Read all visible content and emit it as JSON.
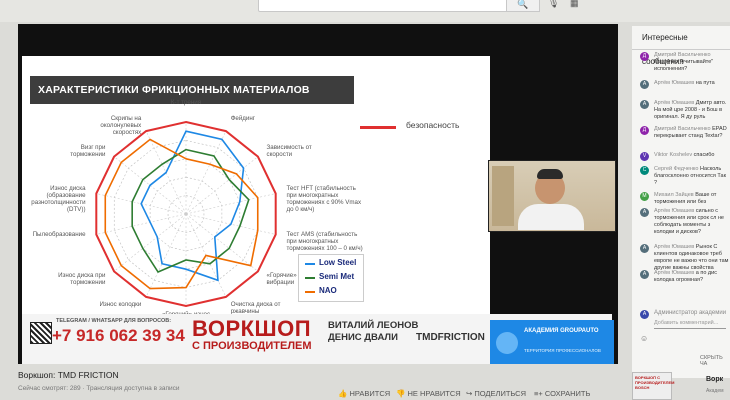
{
  "browser": {
    "search_button": "🔍"
  },
  "slide": {
    "title": "ХАРАКТЕРИСТИКИ ФРИКЦИОННЫХ МАТЕРИАЛОВ",
    "legend_top": "безопасность",
    "axes": [
      "К-т трения",
      "Фейдинг",
      "Зависимость от скорости",
      "Тест HFT (стабильность при многократных торможениях с 90% Vmax до 0 км/ч)",
      "Тест AMS (стабильность при многократных торможениях 100 – 0 км/ч)",
      "«Горячие» вибрации",
      "Очистка диска от ржавчины",
      "«Горячий» износ колодки",
      "Износ колодки",
      "Износ диска при торможении",
      "Пылеобразование",
      "Износ диска (образование разнотолщинности (DTV))",
      "Визг при торможении",
      "Скрипы на околонулевых скоростях"
    ],
    "legend": [
      {
        "name": "Low Steel",
        "color": "#1e88e5"
      },
      {
        "name": "Semi Met",
        "color": "#2e7d32"
      },
      {
        "name": "NAO",
        "color": "#ef6c00"
      }
    ],
    "safety_color": "#e03030"
  },
  "chart_data": {
    "type": "radar",
    "categories": [
      "К-т трения",
      "Фейдинг",
      "Зависимость от скорости",
      "Тест HFT (стабильность при многократных торможениях с 90% Vmax до 0 км/ч)",
      "Тест AMS (стабильность при многократных торможениях 100 – 0 км/ч)",
      "«Горячие» вибрации",
      "Очистка диска от ржавчины",
      "«Горячий» износ колодки",
      "Износ колодки",
      "Износ диска при торможении",
      "Пылеобразование",
      "Износ диска (образование разнотолщинности (DTV))",
      "Визг при торможении",
      "Скрипы на околонулевых скоростях"
    ],
    "scale_max": 5,
    "series": [
      {
        "name": "безопасность",
        "values": [
          5,
          5,
          5,
          5,
          5,
          5,
          5,
          5,
          5,
          5,
          5,
          5,
          5,
          5
        ]
      },
      {
        "name": "Low Steel",
        "values": [
          4.5,
          4.5,
          4,
          3,
          2.5,
          2,
          4,
          3,
          3,
          2,
          2,
          2.5,
          2.5,
          2.5
        ]
      },
      {
        "name": "Semi Met",
        "values": [
          3.5,
          3.5,
          3,
          3.5,
          3,
          3,
          3,
          2.5,
          3.5,
          3,
          3,
          3,
          3,
          3
        ]
      },
      {
        "name": "NAO",
        "values": [
          3,
          3,
          3.5,
          4,
          4,
          4.5,
          2.5,
          4,
          4.5,
          4.5,
          4.5,
          4.5,
          4.5,
          4.5
        ]
      }
    ]
  },
  "banner": {
    "telegram": "TELEGRAM / WHATSAPP ДЛЯ ВОПРОСОВ:",
    "phone": "+7 916 062 39 34",
    "workshop": "ВОРКШОП",
    "workshop_sub": "С ПРОИЗВОДИТЕЛЕМ",
    "speaker1": "ВИТАЛИЙ ЛЕОНОВ",
    "speaker2": "ДЕНИС ДВАЛИ",
    "tmd": "TMDFRICTION",
    "academy_name": "АКАДЕМИЯ GROUPAUTO",
    "academy_sub": "ТЕРРИТОРИЯ ПРОФЕССИОНАЛОВ"
  },
  "video": {
    "title": "Воркшоп: TMD FRICTION",
    "meta": "Сейчас смотрят: 289 · Трансляция доступна в записи",
    "like": "НРАВИТСЯ",
    "dislike": "НЕ НРАВИТСЯ",
    "share": "ПОДЕЛИТЬСЯ",
    "save": "СОХРАНИТЬ"
  },
  "chat": {
    "header": "Интересные сообщения",
    "messages": [
      {
        "avatar": "Д",
        "color": "#8e24aa",
        "name": "Дмитрий Васильченко",
        "text": "Nisshinbo \"учитывайте\" исполнения?"
      },
      {
        "avatar": "А",
        "color": "#546e7a",
        "name": "Артём Юмашев",
        "text": "на пута"
      },
      {
        "avatar": "А",
        "color": "#546e7a",
        "name": "Артём Юмашев",
        "text": "Дмитр авто. На мой цре 2008 - и Бош в оригинал. Я ду руль"
      },
      {
        "avatar": "Д",
        "color": "#8e24aa",
        "name": "Дмитрий Васильченко",
        "text": "EPAD перекрывает станд Textar?"
      },
      {
        "avatar": "V",
        "color": "#5e35b1",
        "name": "Viktor Koshelev",
        "text": "спасибо"
      },
      {
        "avatar": "С",
        "color": "#00897b",
        "name": "Сергей Федченко",
        "text": "Насколь благосклонно относится Так ?"
      },
      {
        "avatar": "М",
        "color": "#43a047",
        "name": "Михаил Зайцев",
        "text": "Ваше от торможения или без"
      },
      {
        "avatar": "А",
        "color": "#546e7a",
        "name": "Артём Юмашев",
        "text": "сильно с торможения или срок сл не соблюдать моменты з колодки и дисков?"
      },
      {
        "avatar": "А",
        "color": "#546e7a",
        "name": "Артём Юмашев",
        "text": "Рынок С клиентов одинаковое треб европе не важно что они там другие важны свойства"
      },
      {
        "avatar": "А",
        "color": "#546e7a",
        "name": "Артём Юмашев",
        "text": "а по дис колодка огромная?"
      },
      {
        "avatar": "А",
        "color": "#3949ab",
        "name": "Администратор академии",
        "text": ""
      }
    ],
    "input_placeholder": "Добавить комментарий...",
    "hide": "СКРЫТЬ ЧА"
  },
  "recommendation": {
    "card": "ВОРКШОП С ПРОИЗВОДИТЕЛЕМ BOSCH",
    "title": "Ворк",
    "sub": "Академ"
  }
}
